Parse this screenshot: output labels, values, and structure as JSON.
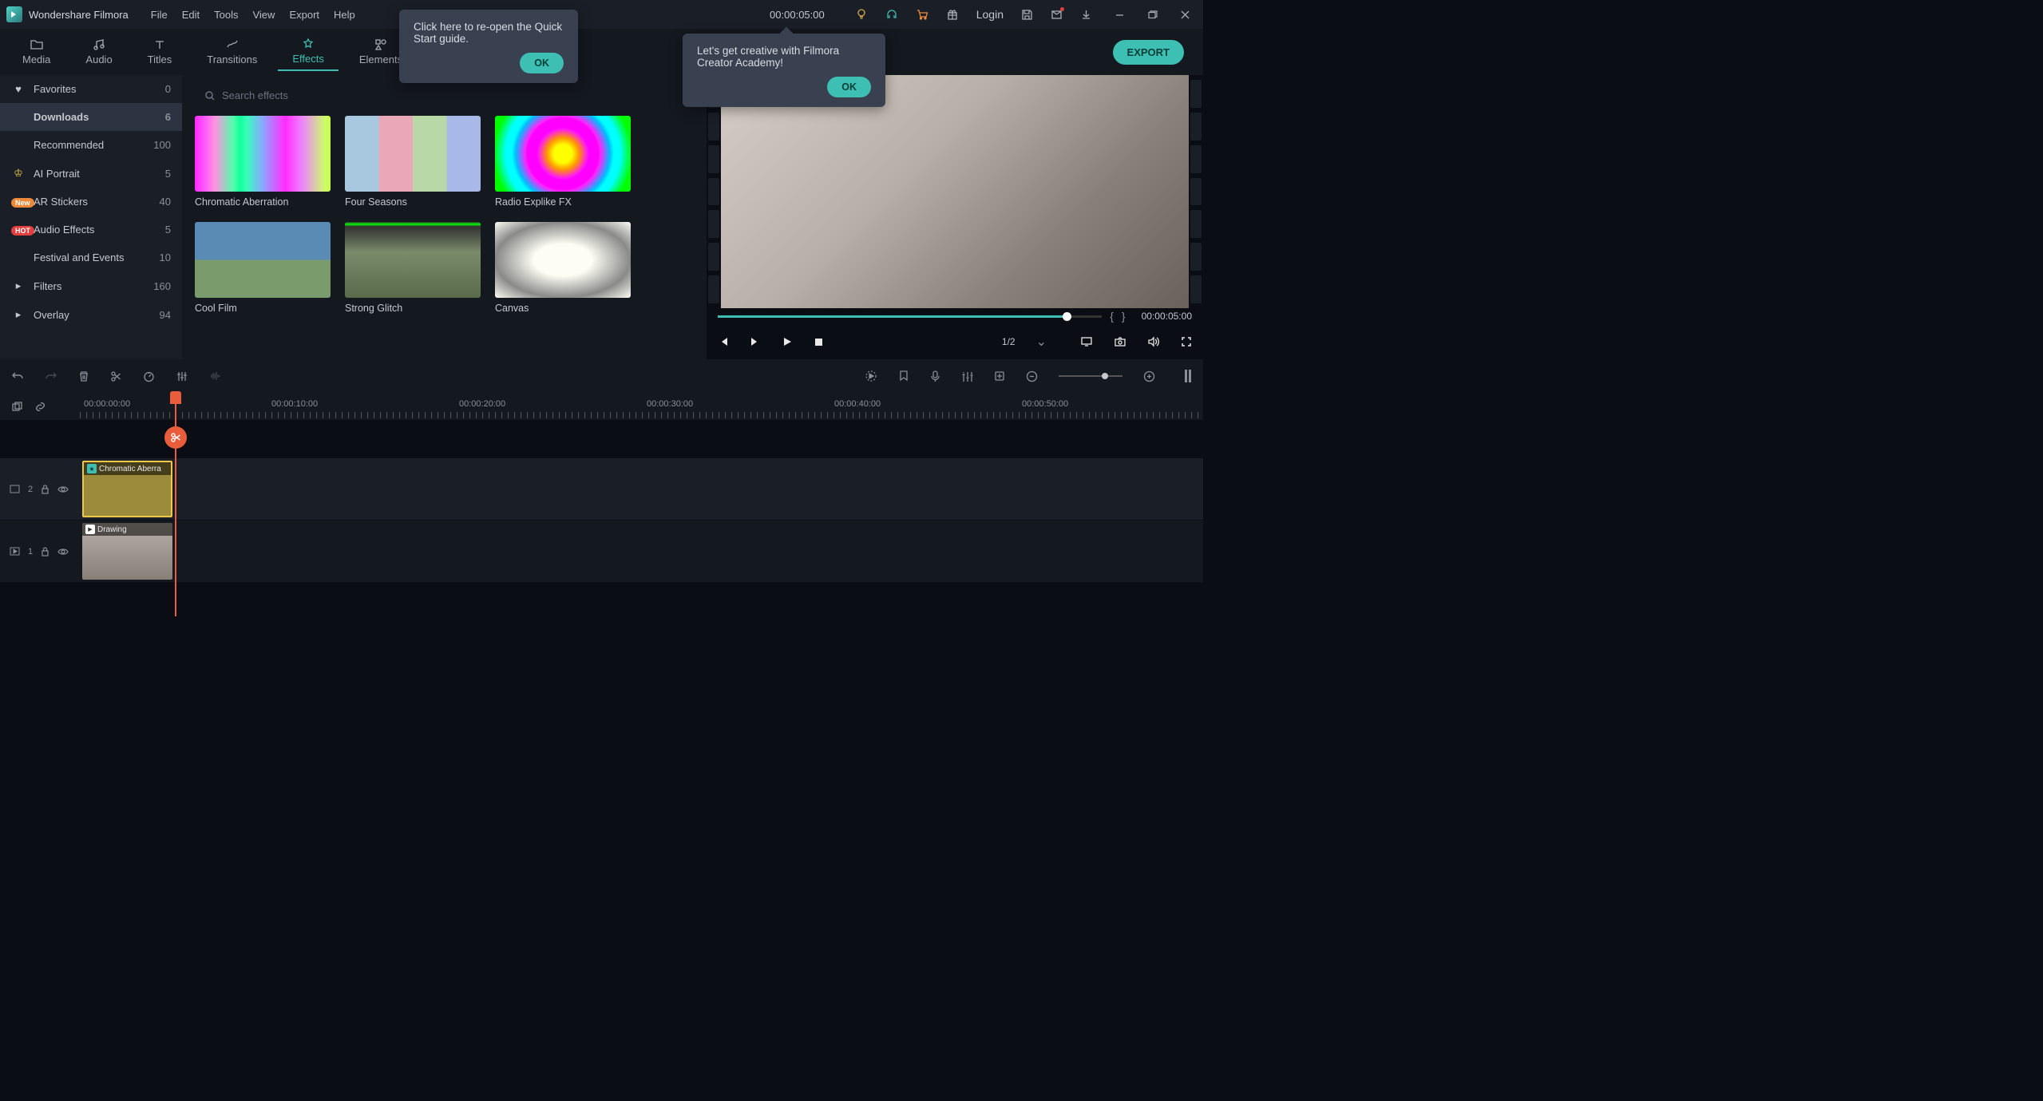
{
  "app": {
    "title": "Wondershare Filmora"
  },
  "menu": [
    "File",
    "Edit",
    "Tools",
    "View",
    "Export",
    "Help"
  ],
  "title_time": "00:00:05:00",
  "login": "Login",
  "tabs": [
    {
      "label": "Media"
    },
    {
      "label": "Audio"
    },
    {
      "label": "Titles"
    },
    {
      "label": "Transitions"
    },
    {
      "label": "Effects"
    },
    {
      "label": "Elements"
    }
  ],
  "export_label": "EXPORT",
  "sidebar": [
    {
      "label": "Favorites",
      "count": "0",
      "icon": "heart"
    },
    {
      "label": "Downloads",
      "count": "6",
      "icon": "",
      "active": true
    },
    {
      "label": "Recommended",
      "count": "100",
      "icon": ""
    },
    {
      "label": "AI Portrait",
      "count": "5",
      "icon": "crown"
    },
    {
      "label": "AR Stickers",
      "count": "40",
      "icon": "new"
    },
    {
      "label": "Audio Effects",
      "count": "5",
      "icon": "hot"
    },
    {
      "label": "Festival and Events",
      "count": "10",
      "icon": ""
    },
    {
      "label": "Filters",
      "count": "160",
      "icon": "arrow"
    },
    {
      "label": "Overlay",
      "count": "94",
      "icon": "arrow"
    }
  ],
  "search": {
    "placeholder": "Search effects"
  },
  "effects": [
    {
      "label": "Chromatic Aberration",
      "cls": "thumb-chromatic"
    },
    {
      "label": "Four Seasons",
      "cls": "thumb-seasons"
    },
    {
      "label": "Radio Explike FX",
      "cls": "thumb-radio"
    },
    {
      "label": "Cool Film",
      "cls": "thumb-cool"
    },
    {
      "label": "Strong Glitch",
      "cls": "thumb-glitch"
    },
    {
      "label": "Canvas",
      "cls": "thumb-canvas"
    }
  ],
  "preview": {
    "time": "00:00:05:00",
    "ratio": "1/2"
  },
  "ruler": [
    "00:00:00:00",
    "00:00:10:00",
    "00:00:20:00",
    "00:00:30:00",
    "00:00:40:00",
    "00:00:50:00"
  ],
  "clips": {
    "effect": "Chromatic Aberra",
    "video": "Drawing"
  },
  "tracks": {
    "t2": "2",
    "t1": "1"
  },
  "popup1": {
    "text": "Click here to re-open the Quick Start guide.",
    "ok": "OK"
  },
  "popup2": {
    "text": "Let's get creative with Filmora Creator Academy!",
    "ok": "OK"
  }
}
